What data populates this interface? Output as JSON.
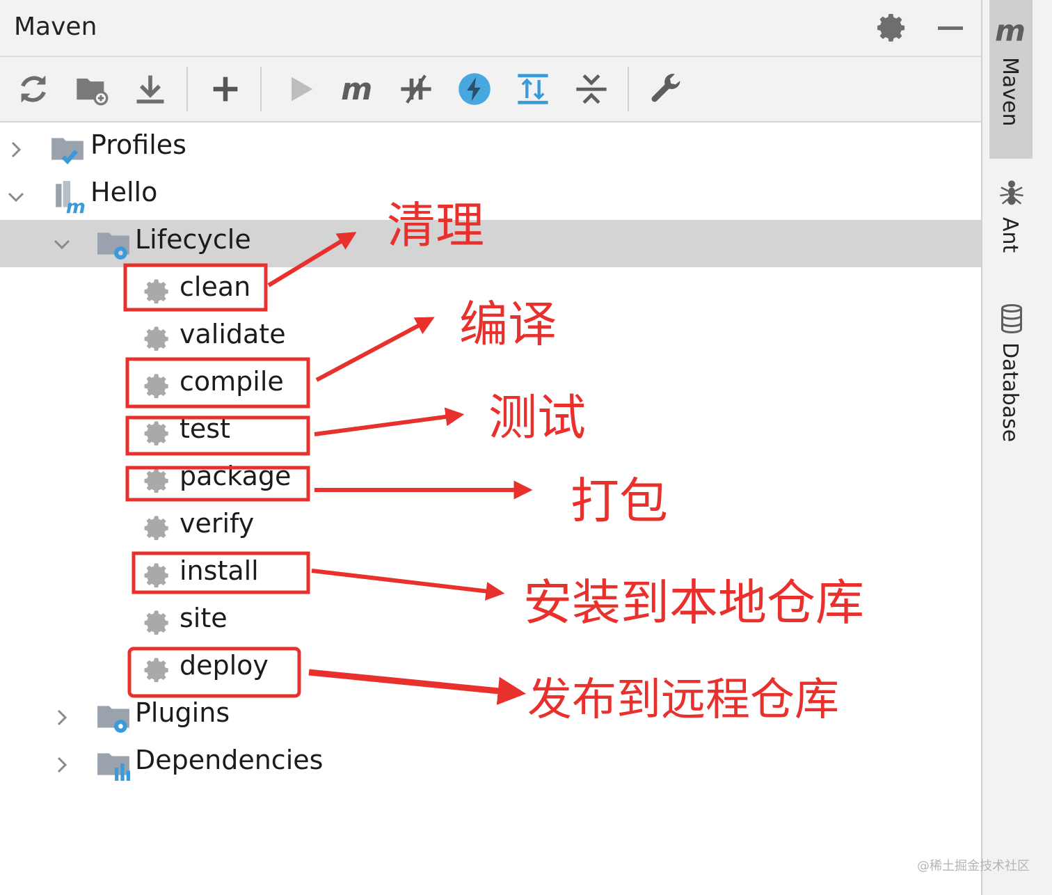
{
  "header": {
    "title": "Maven"
  },
  "tree": {
    "profiles": "Profiles",
    "project": "Hello",
    "lifecycle": "Lifecycle",
    "goals": [
      "clean",
      "validate",
      "compile",
      "test",
      "package",
      "verify",
      "install",
      "site",
      "deploy"
    ],
    "plugins": "Plugins",
    "dependencies": "Dependencies"
  },
  "sidebar": {
    "tabs": [
      "Maven",
      "Ant",
      "Database"
    ]
  },
  "annotations": {
    "clean": "清理",
    "compile": "编译",
    "test": "测试",
    "package": "打包",
    "install": "安装到本地仓库",
    "deploy": "发布到远程仓库"
  },
  "watermark": "@稀土掘金技术社区",
  "colors": {
    "annotation": "#e8302c",
    "selection": "#d4d4d4",
    "accent": "#3b9ad9"
  }
}
